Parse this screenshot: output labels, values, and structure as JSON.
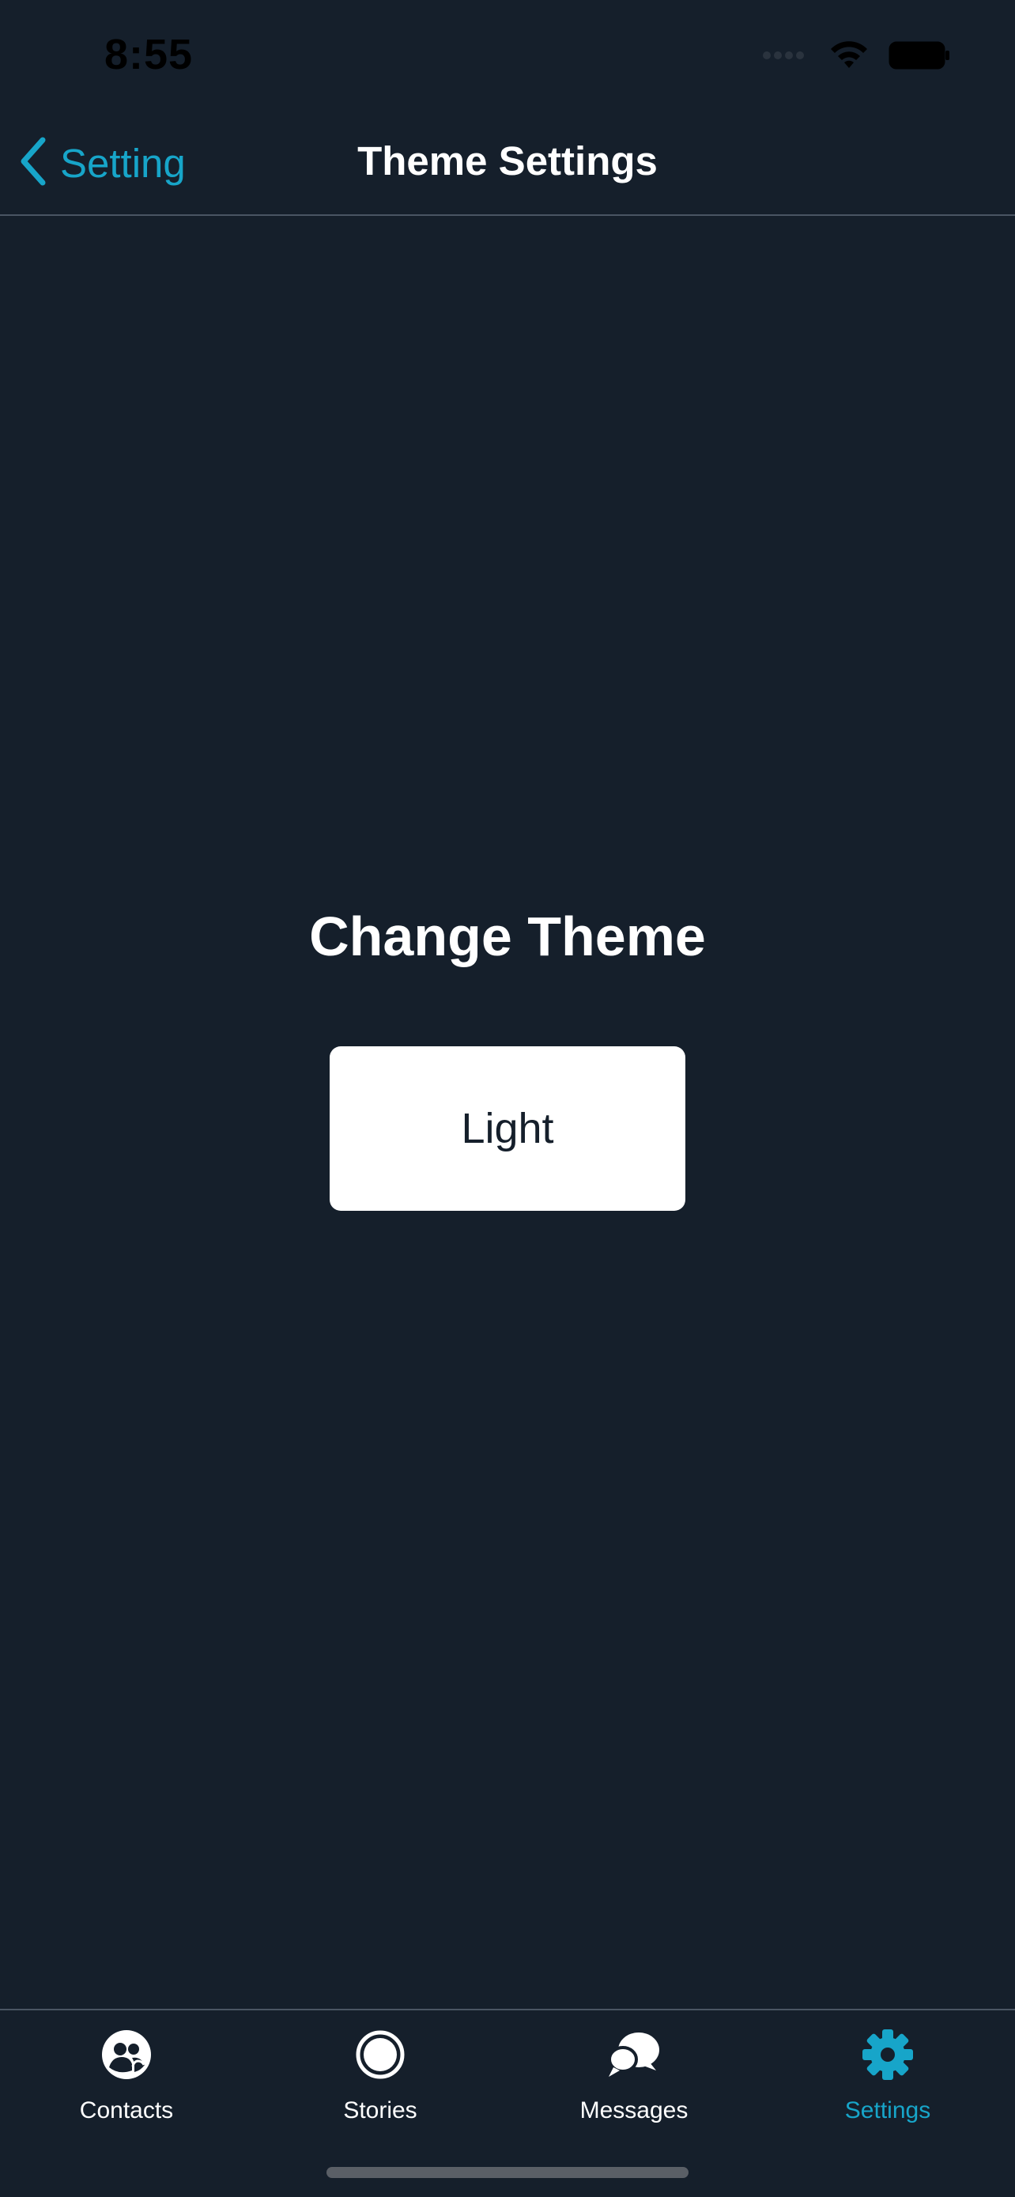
{
  "status_bar": {
    "time": "8:55"
  },
  "nav": {
    "back_label": "Setting",
    "title": "Theme Settings"
  },
  "main": {
    "heading": "Change Theme",
    "theme_button_label": "Light"
  },
  "tab_bar": {
    "tabs": [
      {
        "label": "Contacts",
        "icon": "contacts-icon",
        "active": false
      },
      {
        "label": "Stories",
        "icon": "stories-icon",
        "active": false
      },
      {
        "label": "Messages",
        "icon": "messages-icon",
        "active": false
      },
      {
        "label": "Settings",
        "icon": "gear-icon",
        "active": true
      }
    ]
  },
  "colors": {
    "background": "#151f2b",
    "accent": "#17a5c9",
    "text": "#ffffff",
    "divider": "#4a5563"
  }
}
